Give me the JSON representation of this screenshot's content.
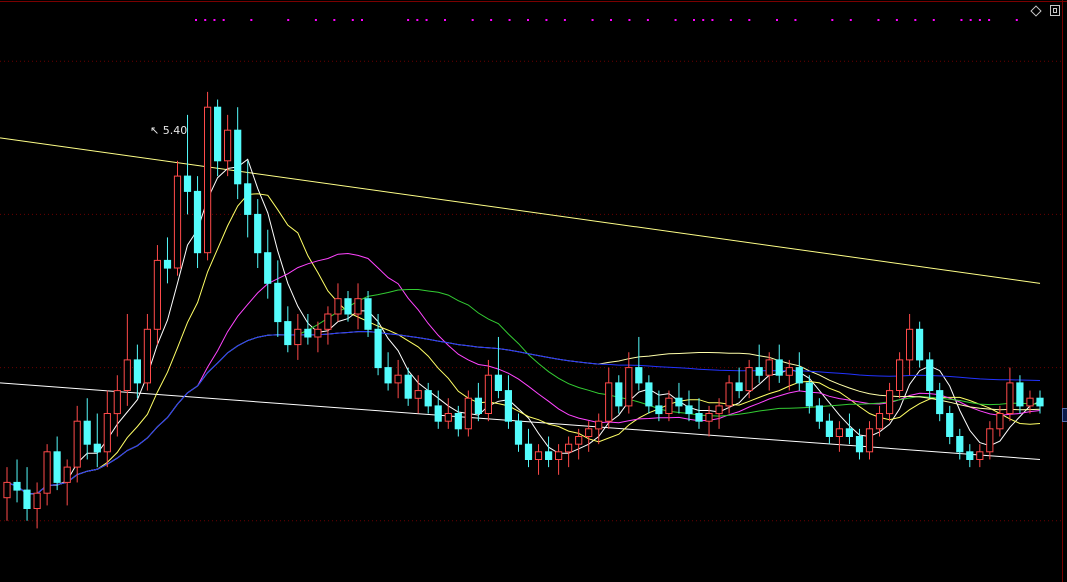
{
  "colors": {
    "background": "#000000",
    "up_candle": "#ff4a4a",
    "down_candle": "#54fcfc",
    "grid": "#6a0000",
    "border": "#7a0000",
    "signal_dots": "#ff00ff",
    "ma5": "#ffffff",
    "ma10": "#ffff66",
    "ma20": "#ff44ff",
    "ma30": "#33cc33",
    "ma60": "#ffffaa",
    "ma120": "#2233ff",
    "trend_line": "#ffff88",
    "support_line": "#ffffff"
  },
  "icons": {
    "settings": "diamond-icon",
    "window": "restore-icon",
    "marker": "edge-marker"
  },
  "peak": {
    "marker_icon": "peak-arrow-icon",
    "text": "5.40"
  },
  "chart_data": {
    "type": "candlestick",
    "grid": true,
    "ylim": [
      2.2,
      6.0
    ],
    "price_lines": [
      5.1,
      4.37
    ],
    "signal_dot_candles": [
      17,
      18,
      19,
      20,
      23,
      27,
      30,
      32,
      34,
      35,
      40,
      41,
      42,
      44,
      47,
      49,
      51,
      53,
      55,
      57,
      60,
      62,
      64,
      66,
      69,
      71,
      72,
      73,
      75,
      77,
      80,
      82,
      86,
      88,
      91,
      93,
      95,
      97,
      100,
      101,
      102,
      103,
      106
    ],
    "candles": [
      {
        "o": 2.75,
        "h": 2.95,
        "l": 2.6,
        "c": 2.85
      },
      {
        "o": 2.85,
        "h": 3.0,
        "l": 2.72,
        "c": 2.8
      },
      {
        "o": 2.8,
        "h": 2.95,
        "l": 2.6,
        "c": 2.68
      },
      {
        "o": 2.68,
        "h": 2.85,
        "l": 2.55,
        "c": 2.78
      },
      {
        "o": 2.78,
        "h": 3.1,
        "l": 2.7,
        "c": 3.05
      },
      {
        "o": 3.05,
        "h": 3.15,
        "l": 2.8,
        "c": 2.85
      },
      {
        "o": 2.85,
        "h": 3.0,
        "l": 2.7,
        "c": 2.95
      },
      {
        "o": 2.95,
        "h": 3.35,
        "l": 2.85,
        "c": 3.25
      },
      {
        "o": 3.25,
        "h": 3.4,
        "l": 3.0,
        "c": 3.1
      },
      {
        "o": 3.1,
        "h": 3.3,
        "l": 2.95,
        "c": 3.05
      },
      {
        "o": 3.05,
        "h": 3.45,
        "l": 2.95,
        "c": 3.3
      },
      {
        "o": 3.3,
        "h": 3.55,
        "l": 3.15,
        "c": 3.45
      },
      {
        "o": 3.45,
        "h": 3.95,
        "l": 3.35,
        "c": 3.65
      },
      {
        "o": 3.65,
        "h": 3.75,
        "l": 3.4,
        "c": 3.5
      },
      {
        "o": 3.5,
        "h": 3.95,
        "l": 3.45,
        "c": 3.85
      },
      {
        "o": 3.85,
        "h": 4.4,
        "l": 3.75,
        "c": 4.3
      },
      {
        "o": 4.3,
        "h": 4.45,
        "l": 4.15,
        "c": 4.25
      },
      {
        "o": 4.25,
        "h": 4.95,
        "l": 4.2,
        "c": 4.85
      },
      {
        "o": 4.85,
        "h": 5.25,
        "l": 4.6,
        "c": 4.75
      },
      {
        "o": 4.75,
        "h": 4.85,
        "l": 4.25,
        "c": 4.35
      },
      {
        "o": 4.35,
        "h": 5.4,
        "l": 4.3,
        "c": 5.3
      },
      {
        "o": 5.3,
        "h": 5.35,
        "l": 4.85,
        "c": 4.95
      },
      {
        "o": 4.95,
        "h": 5.25,
        "l": 4.85,
        "c": 5.15
      },
      {
        "o": 5.15,
        "h": 5.3,
        "l": 4.7,
        "c": 4.8
      },
      {
        "o": 4.8,
        "h": 4.95,
        "l": 4.45,
        "c": 4.6
      },
      {
        "o": 4.6,
        "h": 4.7,
        "l": 4.25,
        "c": 4.35
      },
      {
        "o": 4.35,
        "h": 4.5,
        "l": 4.05,
        "c": 4.15
      },
      {
        "o": 4.15,
        "h": 4.3,
        "l": 3.8,
        "c": 3.9
      },
      {
        "o": 3.9,
        "h": 4.0,
        "l": 3.7,
        "c": 3.75
      },
      {
        "o": 3.75,
        "h": 3.95,
        "l": 3.65,
        "c": 3.85
      },
      {
        "o": 3.85,
        "h": 3.95,
        "l": 3.75,
        "c": 3.8
      },
      {
        "o": 3.8,
        "h": 3.9,
        "l": 3.7,
        "c": 3.85
      },
      {
        "o": 3.85,
        "h": 4.0,
        "l": 3.75,
        "c": 3.95
      },
      {
        "o": 3.95,
        "h": 4.15,
        "l": 3.9,
        "c": 4.05
      },
      {
        "o": 4.05,
        "h": 4.1,
        "l": 3.9,
        "c": 3.95
      },
      {
        "o": 3.95,
        "h": 4.15,
        "l": 3.85,
        "c": 4.05
      },
      {
        "o": 4.05,
        "h": 4.1,
        "l": 3.8,
        "c": 3.85
      },
      {
        "o": 3.85,
        "h": 3.95,
        "l": 3.55,
        "c": 3.6
      },
      {
        "o": 3.6,
        "h": 3.7,
        "l": 3.45,
        "c": 3.5
      },
      {
        "o": 3.5,
        "h": 3.65,
        "l": 3.4,
        "c": 3.55
      },
      {
        "o": 3.55,
        "h": 3.6,
        "l": 3.35,
        "c": 3.4
      },
      {
        "o": 3.4,
        "h": 3.55,
        "l": 3.3,
        "c": 3.45
      },
      {
        "o": 3.45,
        "h": 3.5,
        "l": 3.3,
        "c": 3.35
      },
      {
        "o": 3.35,
        "h": 3.45,
        "l": 3.2,
        "c": 3.25
      },
      {
        "o": 3.25,
        "h": 3.4,
        "l": 3.2,
        "c": 3.3
      },
      {
        "o": 3.3,
        "h": 3.35,
        "l": 3.15,
        "c": 3.2
      },
      {
        "o": 3.2,
        "h": 3.45,
        "l": 3.15,
        "c": 3.4
      },
      {
        "o": 3.4,
        "h": 3.5,
        "l": 3.25,
        "c": 3.3
      },
      {
        "o": 3.3,
        "h": 3.65,
        "l": 3.25,
        "c": 3.55
      },
      {
        "o": 3.55,
        "h": 3.8,
        "l": 3.4,
        "c": 3.45
      },
      {
        "o": 3.45,
        "h": 3.55,
        "l": 3.2,
        "c": 3.25
      },
      {
        "o": 3.25,
        "h": 3.3,
        "l": 3.05,
        "c": 3.1
      },
      {
        "o": 3.1,
        "h": 3.2,
        "l": 2.95,
        "c": 3.0
      },
      {
        "o": 3.0,
        "h": 3.1,
        "l": 2.9,
        "c": 3.05
      },
      {
        "o": 3.05,
        "h": 3.15,
        "l": 2.95,
        "c": 3.0
      },
      {
        "o": 3.0,
        "h": 3.1,
        "l": 2.9,
        "c": 3.05
      },
      {
        "o": 3.05,
        "h": 3.15,
        "l": 2.95,
        "c": 3.1
      },
      {
        "o": 3.1,
        "h": 3.2,
        "l": 3.0,
        "c": 3.15
      },
      {
        "o": 3.15,
        "h": 3.25,
        "l": 3.05,
        "c": 3.2
      },
      {
        "o": 3.2,
        "h": 3.3,
        "l": 3.1,
        "c": 3.25
      },
      {
        "o": 3.25,
        "h": 3.6,
        "l": 3.2,
        "c": 3.5
      },
      {
        "o": 3.5,
        "h": 3.55,
        "l": 3.3,
        "c": 3.35
      },
      {
        "o": 3.35,
        "h": 3.7,
        "l": 3.3,
        "c": 3.6
      },
      {
        "o": 3.6,
        "h": 3.8,
        "l": 3.45,
        "c": 3.5
      },
      {
        "o": 3.5,
        "h": 3.55,
        "l": 3.3,
        "c": 3.35
      },
      {
        "o": 3.35,
        "h": 3.45,
        "l": 3.25,
        "c": 3.3
      },
      {
        "o": 3.3,
        "h": 3.45,
        "l": 3.25,
        "c": 3.4
      },
      {
        "o": 3.4,
        "h": 3.5,
        "l": 3.3,
        "c": 3.35
      },
      {
        "o": 3.35,
        "h": 3.45,
        "l": 3.25,
        "c": 3.3
      },
      {
        "o": 3.3,
        "h": 3.4,
        "l": 3.2,
        "c": 3.25
      },
      {
        "o": 3.25,
        "h": 3.35,
        "l": 3.15,
        "c": 3.3
      },
      {
        "o": 3.3,
        "h": 3.4,
        "l": 3.2,
        "c": 3.35
      },
      {
        "o": 3.35,
        "h": 3.55,
        "l": 3.3,
        "c": 3.5
      },
      {
        "o": 3.5,
        "h": 3.6,
        "l": 3.4,
        "c": 3.45
      },
      {
        "o": 3.45,
        "h": 3.65,
        "l": 3.4,
        "c": 3.6
      },
      {
        "o": 3.6,
        "h": 3.75,
        "l": 3.5,
        "c": 3.55
      },
      {
        "o": 3.55,
        "h": 3.7,
        "l": 3.45,
        "c": 3.65
      },
      {
        "o": 3.65,
        "h": 3.75,
        "l": 3.5,
        "c": 3.55
      },
      {
        "o": 3.55,
        "h": 3.65,
        "l": 3.45,
        "c": 3.6
      },
      {
        "o": 3.6,
        "h": 3.7,
        "l": 3.45,
        "c": 3.5
      },
      {
        "o": 3.5,
        "h": 3.55,
        "l": 3.3,
        "c": 3.35
      },
      {
        "o": 3.35,
        "h": 3.4,
        "l": 3.2,
        "c": 3.25
      },
      {
        "o": 3.25,
        "h": 3.3,
        "l": 3.1,
        "c": 3.15
      },
      {
        "o": 3.15,
        "h": 3.25,
        "l": 3.05,
        "c": 3.2
      },
      {
        "o": 3.2,
        "h": 3.3,
        "l": 3.1,
        "c": 3.15
      },
      {
        "o": 3.15,
        "h": 3.2,
        "l": 3.0,
        "c": 3.05
      },
      {
        "o": 3.05,
        "h": 3.25,
        "l": 3.0,
        "c": 3.2
      },
      {
        "o": 3.2,
        "h": 3.35,
        "l": 3.15,
        "c": 3.3
      },
      {
        "o": 3.3,
        "h": 3.5,
        "l": 3.25,
        "c": 3.45
      },
      {
        "o": 3.45,
        "h": 3.7,
        "l": 3.4,
        "c": 3.65
      },
      {
        "o": 3.65,
        "h": 3.95,
        "l": 3.55,
        "c": 3.85
      },
      {
        "o": 3.85,
        "h": 3.9,
        "l": 3.6,
        "c": 3.65
      },
      {
        "o": 3.65,
        "h": 3.7,
        "l": 3.4,
        "c": 3.45
      },
      {
        "o": 3.45,
        "h": 3.5,
        "l": 3.25,
        "c": 3.3
      },
      {
        "o": 3.3,
        "h": 3.35,
        "l": 3.1,
        "c": 3.15
      },
      {
        "o": 3.15,
        "h": 3.2,
        "l": 3.0,
        "c": 3.05
      },
      {
        "o": 3.05,
        "h": 3.1,
        "l": 2.95,
        "c": 3.0
      },
      {
        "o": 3.0,
        "h": 3.1,
        "l": 2.95,
        "c": 3.05
      },
      {
        "o": 3.05,
        "h": 3.25,
        "l": 3.0,
        "c": 3.2
      },
      {
        "o": 3.2,
        "h": 3.35,
        "l": 3.15,
        "c": 3.3
      },
      {
        "o": 3.3,
        "h": 3.6,
        "l": 3.25,
        "c": 3.5
      },
      {
        "o": 3.5,
        "h": 3.55,
        "l": 3.3,
        "c": 3.35
      },
      {
        "o": 3.35,
        "h": 3.45,
        "l": 3.3,
        "c": 3.4
      },
      {
        "o": 3.4,
        "h": 3.45,
        "l": 3.3,
        "c": 3.35
      }
    ]
  }
}
